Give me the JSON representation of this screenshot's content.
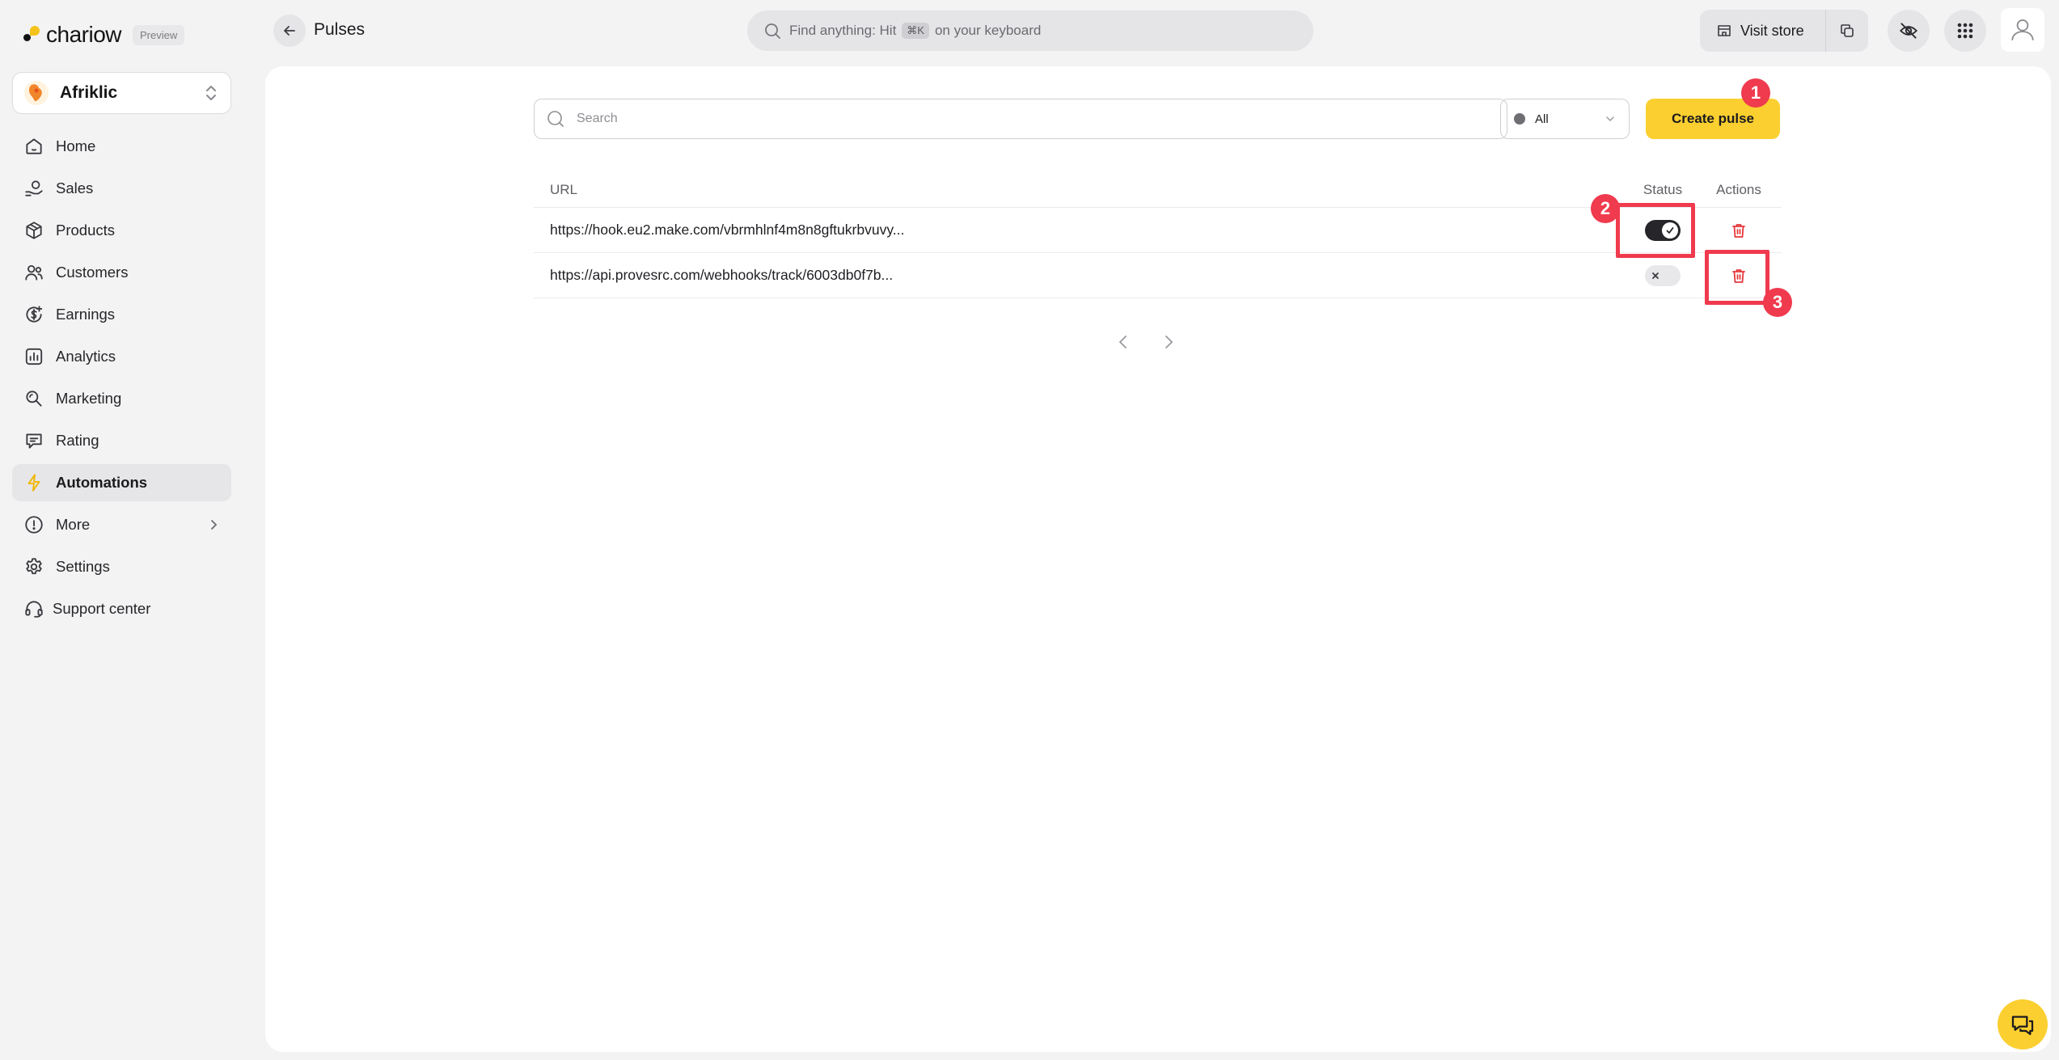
{
  "brand": {
    "name": "chariow",
    "badge": "Preview"
  },
  "store": {
    "name": "Afriklic"
  },
  "sidebar": {
    "items": [
      {
        "label": "Home",
        "icon": "home-icon"
      },
      {
        "label": "Sales",
        "icon": "sales-icon"
      },
      {
        "label": "Products",
        "icon": "box-icon"
      },
      {
        "label": "Customers",
        "icon": "users-icon"
      },
      {
        "label": "Earnings",
        "icon": "dollar-icon"
      },
      {
        "label": "Analytics",
        "icon": "chart-icon"
      },
      {
        "label": "Marketing",
        "icon": "megaphone-icon"
      },
      {
        "label": "Rating",
        "icon": "message-icon"
      },
      {
        "label": "Automations",
        "icon": "bolt-icon",
        "active": true
      },
      {
        "label": "More",
        "icon": "info-icon"
      },
      {
        "label": "Settings",
        "icon": "gear-icon"
      },
      {
        "label": "Support center",
        "icon": "headset-icon"
      }
    ]
  },
  "header": {
    "title": "Pulses",
    "search_prefix": "Find anything: Hit",
    "search_kbd": "⌘K",
    "search_suffix": "on your keyboard",
    "visit_store": "Visit store"
  },
  "toolbar": {
    "search_placeholder": "Search",
    "filter_value": "All",
    "create_label": "Create pulse"
  },
  "table": {
    "columns": {
      "url": "URL",
      "status": "Status",
      "actions": "Actions"
    },
    "rows": [
      {
        "url": "https://hook.eu2.make.com/vbrmhlnf4m8n8gftukrbvuvy...",
        "status": "on"
      },
      {
        "url": "https://api.provesrc.com/webhooks/track/6003db0f7b...",
        "status": "off"
      }
    ]
  },
  "annotations": {
    "one": "1",
    "two": "2",
    "three": "3"
  },
  "colors": {
    "accent": "#fbcf2f",
    "danger": "#e5383b",
    "annotation": "#f03a4e"
  }
}
